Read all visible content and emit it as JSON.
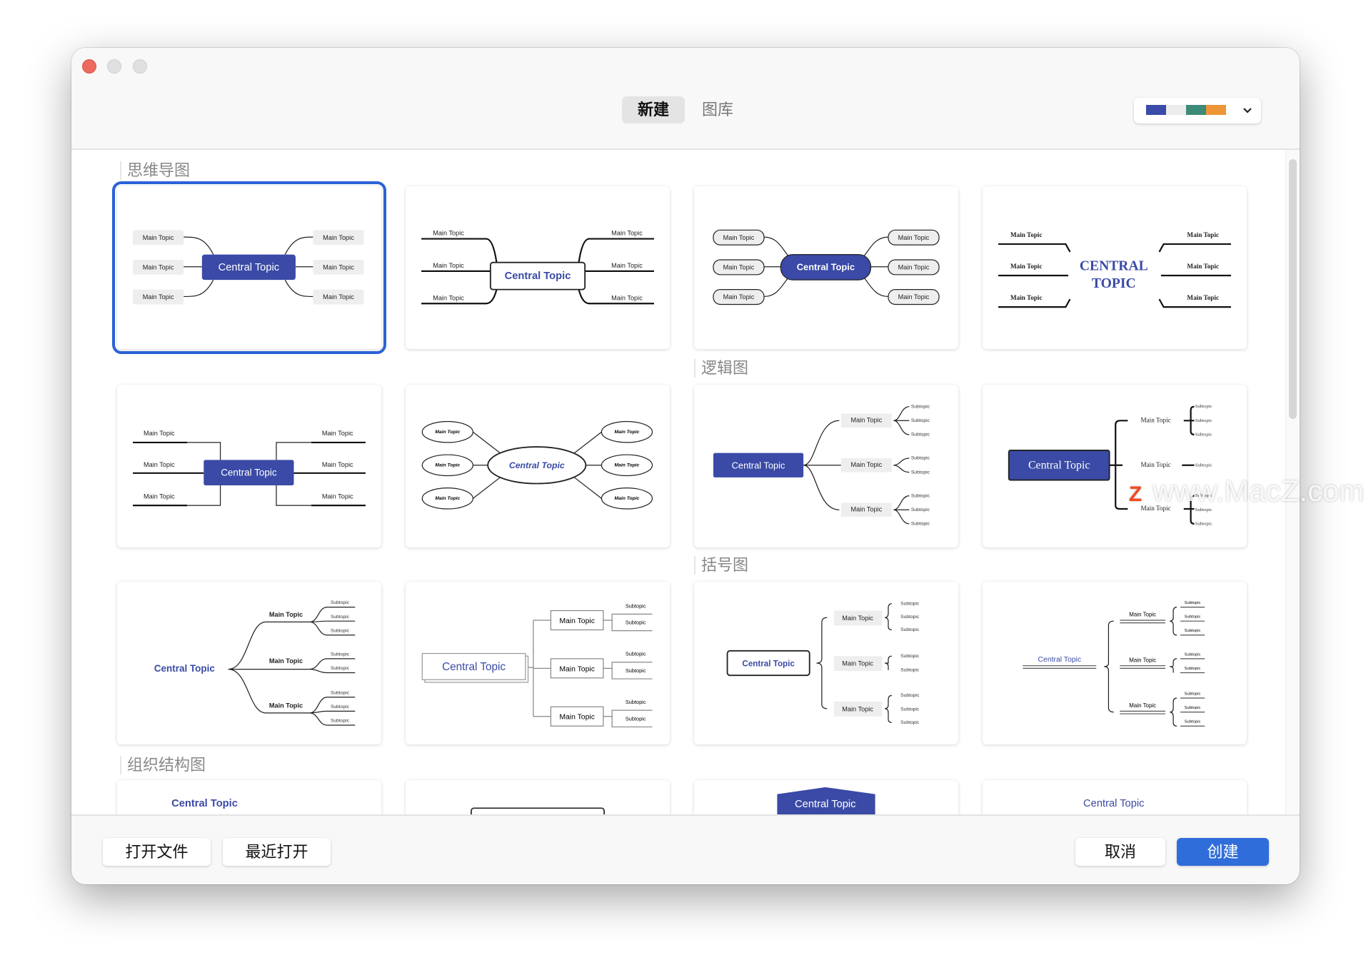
{
  "window": {
    "tabs": [
      {
        "label": "新建",
        "active": true
      },
      {
        "label": "图库",
        "active": false
      }
    ]
  },
  "theme_picker": {
    "colors": [
      "#3b4ba8",
      "#ececec",
      "#3d8a78",
      "#ee9536"
    ],
    "icon": "chevron-down-icon",
    "chevron": "⌄"
  },
  "sections": [
    {
      "label": "思维导图"
    },
    {
      "label": "逻辑图"
    },
    {
      "label": "括号图"
    },
    {
      "label": "组织结构图"
    }
  ],
  "accent_color": "#3a4aa6",
  "selection_color": "#2b62d6",
  "cards": [
    {
      "central": "Central Topic",
      "main": "Main Topic",
      "selected": true
    },
    {
      "central": "Central Topic",
      "main": "Main Topic"
    },
    {
      "central": "Central Topic",
      "main": "Main Topic"
    },
    {
      "central_lines": [
        "CENTRAL",
        "TOPIC"
      ],
      "main": "Main Topic"
    },
    {
      "central": "Central Topic",
      "main": "Main Topic"
    },
    {
      "central": "Central Topic",
      "main": "Main Topic"
    },
    {
      "central": "Central Topic",
      "main": "Main Topic",
      "sub": "Subtopic"
    },
    {
      "central": "Central Topic",
      "main": "Main Topic",
      "sub": "Subtopic"
    },
    {
      "central": "Central Topic",
      "main": "Main Topic",
      "sub": "Subtopic"
    },
    {
      "central": "Central Topic",
      "main": "Main Topic",
      "sub": "Subtopic"
    },
    {
      "central": "Central Topic",
      "main": "Main Topic",
      "sub": "Subtopic"
    },
    {
      "central": "Central Topic",
      "main": "Main Topic",
      "sub": "Subtopic"
    },
    {
      "central": "Central Topic"
    },
    {
      "central": ""
    },
    {
      "central": "Central Topic"
    },
    {
      "central": "Central Topic"
    }
  ],
  "footer": {
    "open_file": "打开文件",
    "recent": "最近打开",
    "cancel": "取消",
    "create": "创建"
  },
  "watermark": {
    "letter": "Z",
    "text": "www.MacZ.com"
  }
}
